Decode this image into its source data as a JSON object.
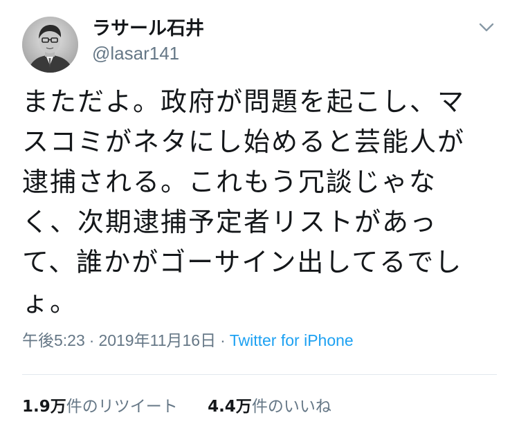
{
  "tweet": {
    "author": {
      "display_name": "ラサール石井",
      "handle": "@lasar141"
    },
    "text": "まただよ。政府が問題を起こし、マ\nスコミがネタにし始めると芸能人が\n逮捕される。これもう冗談じゃな\nく、次期逮捕予定者リストがあっ\nて、誰かがゴーサイン出してるでし\nょ。",
    "time": "午後5:23",
    "date": "2019年11月16日",
    "source": "Twitter for iPhone",
    "separator": "·",
    "retweets": {
      "count": "1.9万",
      "label": "件のリツイート"
    },
    "likes": {
      "count": "4.4万",
      "label": "件のいいね"
    }
  },
  "icons": {
    "menu": "chevron-down-icon",
    "avatar": "profile-photo"
  },
  "colors": {
    "text": "#14171a",
    "muted": "#657786",
    "link": "#1da1f2",
    "divider": "#e1e8ed"
  }
}
